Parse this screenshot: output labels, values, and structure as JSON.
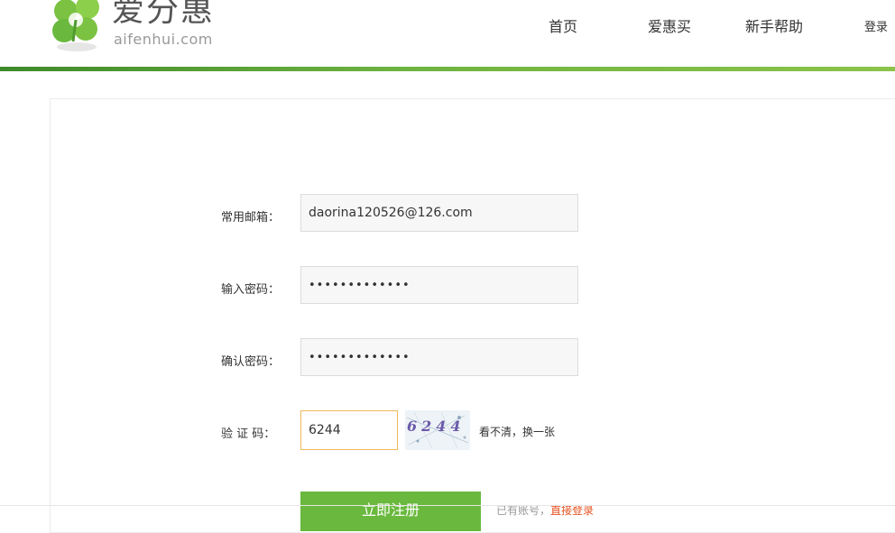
{
  "header": {
    "brand_cn": "爱分惠",
    "brand_en": "aifenhui.com",
    "nav": [
      {
        "label": "首页"
      },
      {
        "label": "爱惠买"
      },
      {
        "label": "新手帮助"
      }
    ],
    "login": "登录"
  },
  "form": {
    "email_label": "常用邮箱：",
    "email_value": "daorina120526@126.com",
    "password_label": "输入密码：",
    "password_value": "•••••••••••••",
    "confirm_label": "确认密码：",
    "confirm_value": "•••••••••••••",
    "captcha_label": "验 证 码：",
    "captcha_value": "6244",
    "captcha_image_text": "6244",
    "captcha_refresh": "看不清，换一张",
    "submit_label": "立即注册",
    "login_hint": "已有账号，",
    "login_link": "直接登录"
  },
  "colors": {
    "brand_green": "#6ab93e",
    "accent_orange": "#e5511d",
    "captcha_focus": "#f0b75b"
  }
}
